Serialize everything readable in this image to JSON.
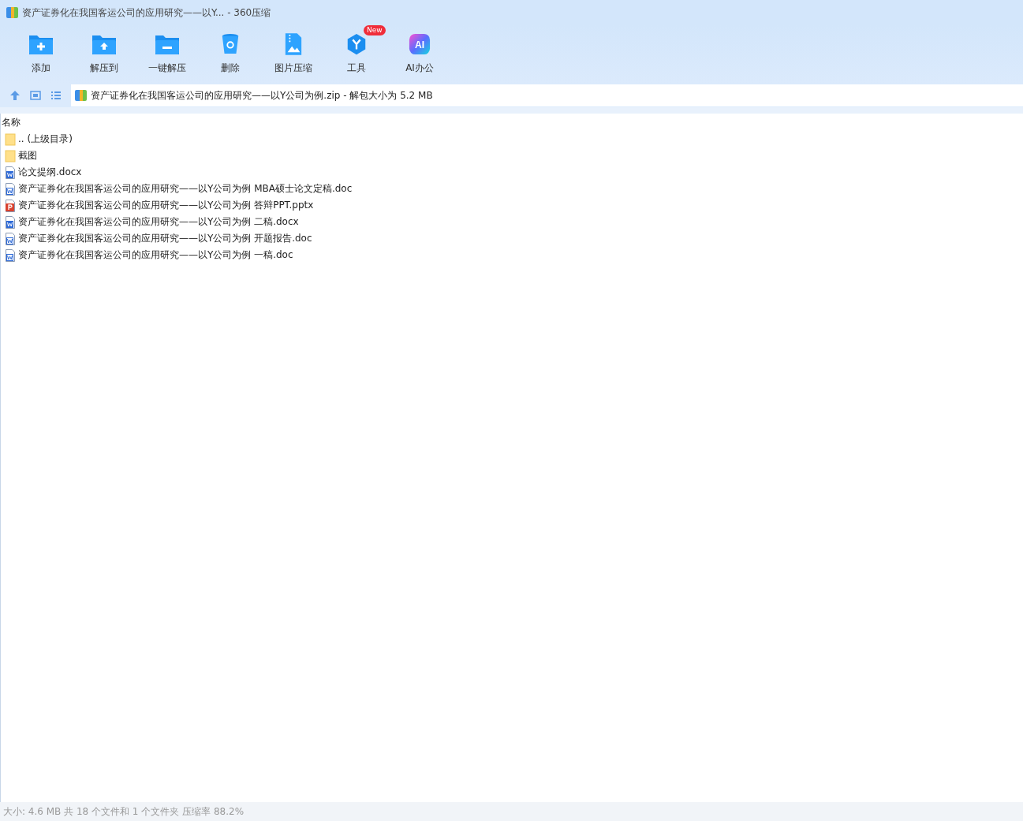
{
  "window": {
    "title": "资产证券化在我国客运公司的应用研究——以Y... - 360压缩"
  },
  "toolbar": [
    {
      "kind": "add",
      "label": "添加"
    },
    {
      "kind": "extract",
      "label": "解压到"
    },
    {
      "kind": "oneclick",
      "label": "一键解压"
    },
    {
      "kind": "delete",
      "label": "删除"
    },
    {
      "kind": "image",
      "label": "图片压缩"
    },
    {
      "kind": "tools",
      "label": "工具",
      "badge": "New"
    },
    {
      "kind": "ai",
      "label": "AI办公",
      "icon_text": "AI"
    }
  ],
  "address": {
    "value": "资产证券化在我国客运公司的应用研究——以Y公司为例.zip - 解包大小为 5.2 MB"
  },
  "table": {
    "columns": [
      "名称"
    ],
    "rows": [
      {
        "kind": "folder",
        "name": ".. (上级目录)"
      },
      {
        "kind": "folder",
        "name": "截图"
      },
      {
        "kind": "docx",
        "name": "论文提纲.docx"
      },
      {
        "kind": "doc",
        "name": "资产证券化在我国客运公司的应用研究——以Y公司为例 MBA硕士论文定稿.doc"
      },
      {
        "kind": "pptx",
        "name": "资产证券化在我国客运公司的应用研究——以Y公司为例 答辩PPT.pptx"
      },
      {
        "kind": "docx",
        "name": "资产证券化在我国客运公司的应用研究——以Y公司为例 二稿.docx"
      },
      {
        "kind": "doc",
        "name": "资产证券化在我国客运公司的应用研究——以Y公司为例 开题报告.doc"
      },
      {
        "kind": "doc",
        "name": "资产证券化在我国客运公司的应用研究——以Y公司为例 一稿.doc"
      }
    ]
  },
  "status_bar": "大小: 4.6 MB 共 18 个文件和 1 个文件夹 压缩率 88.2%"
}
